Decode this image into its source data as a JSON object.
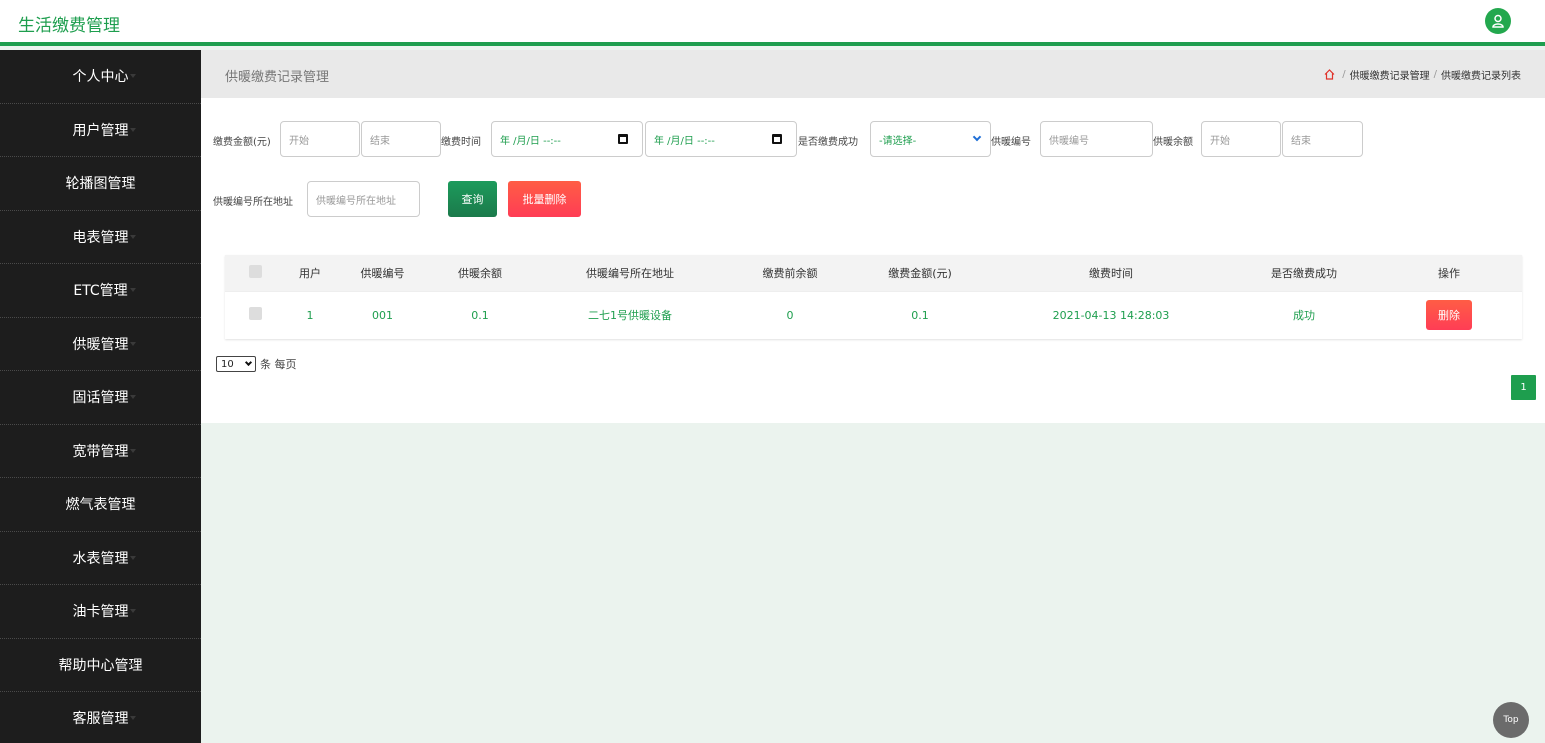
{
  "app": {
    "title": "生活缴费管理"
  },
  "sidebar": {
    "items": [
      {
        "label": "个人中心"
      },
      {
        "label": "用户管理"
      },
      {
        "label": "轮播图管理"
      },
      {
        "label": "电表管理"
      },
      {
        "label": "ETC管理"
      },
      {
        "label": "供暖管理"
      },
      {
        "label": "固话管理"
      },
      {
        "label": "宽带管理"
      },
      {
        "label": "燃气表管理"
      },
      {
        "label": "水表管理"
      },
      {
        "label": "油卡管理"
      },
      {
        "label": "帮助中心管理"
      },
      {
        "label": "客服管理"
      }
    ]
  },
  "header": {
    "page_title": "供暖缴费记录管理",
    "breadcrumb": [
      "供暖缴费记录管理",
      "供暖缴费记录列表"
    ],
    "breadcrumb_sep": "/"
  },
  "filters": {
    "amount_label": "缴费金额(元)",
    "amount_start_placeholder": "开始",
    "amount_end_placeholder": "结束",
    "time_label": "缴费时间",
    "date_start_placeholder": "年 /月/日 --:--",
    "date_end_placeholder": "年 /月/日 --:--",
    "success_label": "是否缴费成功",
    "success_select_value": "-请选择-",
    "code_label": "供暖编号",
    "code_placeholder": "供暖编号",
    "balance_label": "供暖余额",
    "balance_start_placeholder": "开始",
    "balance_end_placeholder": "结束",
    "address_label": "供暖编号所在地址",
    "address_placeholder": "供暖编号所在地址",
    "search_button": "查询",
    "batch_delete_button": "批量删除"
  },
  "table": {
    "columns": [
      "用户",
      "供暖编号",
      "供暖余额",
      "供暖编号所在地址",
      "缴费前余额",
      "缴费金额(元)",
      "缴费时间",
      "是否缴费成功",
      "操作"
    ],
    "rows": [
      {
        "user": "1",
        "code": "001",
        "balance": "0.1",
        "address": "二七1号供暖设备",
        "before_balance": "0",
        "amount": "0.1",
        "time": "2021-04-13 14:28:03",
        "success": "成功",
        "action": "删除"
      }
    ]
  },
  "pagination": {
    "page_size": "10",
    "page_size_suffix": "条 每页",
    "current_page": "1"
  },
  "back_to_top": "Top",
  "colors": {
    "accent": "#1e9e4e",
    "danger": "#ff4550",
    "sidebar_bg": "#1d1d1d"
  },
  "icons": {
    "avatar": "user-icon",
    "home": "home-icon",
    "calendar": "calendar-icon"
  }
}
